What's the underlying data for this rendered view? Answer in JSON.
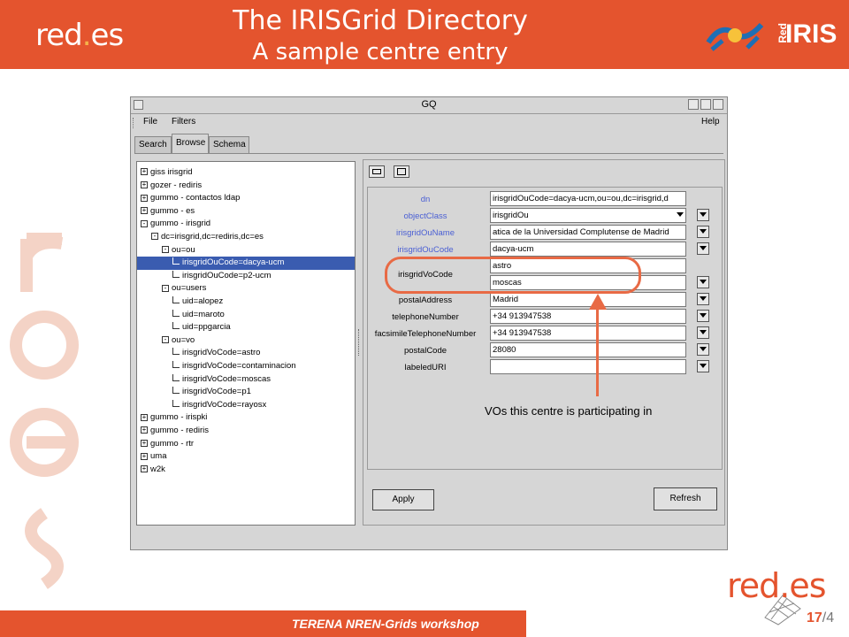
{
  "slide": {
    "title_line1": "The IRISGrid Directory",
    "title_line2": "A sample centre entry",
    "logo_left": "red",
    "logo_left_dot": ".",
    "logo_left_suffix": "es",
    "rediris_small": "Red",
    "rediris_big": "IRIS",
    "footer": "TERENA NREN-Grids workshop",
    "page_current": "17",
    "page_sep": "/",
    "page_total": "4",
    "logo_bottom": "red.es",
    "annotation": "VOs this centre is participating in",
    "colors": {
      "accent": "#e4542e",
      "highlight": "#e86a45",
      "selection": "#3a5cb0",
      "attr_label_blue": "#4a5fd4"
    }
  },
  "window": {
    "title": "GQ",
    "menu": {
      "file": "File",
      "filters": "Filters",
      "help": "Help"
    },
    "tabs": [
      "Search",
      "Browse",
      "Schema"
    ],
    "active_tab": "Browse",
    "tree": [
      {
        "label": "giss irisgrid",
        "type": "expander",
        "sign": "+",
        "level": 0
      },
      {
        "label": "gozer - rediris",
        "type": "expander",
        "sign": "+",
        "level": 0
      },
      {
        "label": "gummo - contactos ldap",
        "type": "expander",
        "sign": "+",
        "level": 0
      },
      {
        "label": "gummo - es",
        "type": "expander",
        "sign": "+",
        "level": 0
      },
      {
        "label": "gummo - irisgrid",
        "type": "expander",
        "sign": "-",
        "level": 0
      },
      {
        "label": "dc=irisgrid,dc=rediris,dc=es",
        "type": "expander",
        "sign": "-",
        "level": 1
      },
      {
        "label": "ou=ou",
        "type": "expander",
        "sign": "-",
        "level": 2
      },
      {
        "label": "irisgridOuCode=dacya-ucm",
        "type": "leaf",
        "level": 3,
        "selected": true
      },
      {
        "label": "irisgridOuCode=p2-ucm",
        "type": "leaf",
        "level": 3
      },
      {
        "label": "ou=users",
        "type": "expander",
        "sign": "-",
        "level": 2
      },
      {
        "label": "uid=alopez",
        "type": "leaf",
        "level": 3
      },
      {
        "label": "uid=maroto",
        "type": "leaf",
        "level": 3
      },
      {
        "label": "uid=ppgarcia",
        "type": "leaf",
        "level": 3
      },
      {
        "label": "ou=vo",
        "type": "expander",
        "sign": "-",
        "level": 2
      },
      {
        "label": "irisgridVoCode=astro",
        "type": "leaf",
        "level": 3
      },
      {
        "label": "irisgridVoCode=contaminacion",
        "type": "leaf",
        "level": 3
      },
      {
        "label": "irisgridVoCode=moscas",
        "type": "leaf",
        "level": 3
      },
      {
        "label": "irisgridVoCode=p1",
        "type": "leaf",
        "level": 3
      },
      {
        "label": "irisgridVoCode=rayosx",
        "type": "leaf",
        "level": 3
      },
      {
        "label": "gummo - irispki",
        "type": "expander",
        "sign": "+",
        "level": 0
      },
      {
        "label": "gummo - rediris",
        "type": "expander",
        "sign": "+",
        "level": 0
      },
      {
        "label": "gummo - rtr",
        "type": "expander",
        "sign": "+",
        "level": 0
      },
      {
        "label": "uma",
        "type": "expander",
        "sign": "+",
        "level": 0
      },
      {
        "label": "w2k",
        "type": "expander",
        "sign": "+",
        "level": 0
      }
    ],
    "attributes": {
      "dn": {
        "label": "dn",
        "value": "irisgridOuCode=dacya-ucm,ou=ou,dc=irisgrid,d"
      },
      "objectClass": {
        "label": "objectClass",
        "value": "irisgridOu"
      },
      "irisgridOuName": {
        "label": "irisgridOuName",
        "value": "atica de la Universidad Complutense de Madrid"
      },
      "irisgridOuCode": {
        "label": "irisgridOuCode",
        "value": "dacya-ucm"
      },
      "irisgridVoCode": {
        "label": "irisgridVoCode",
        "values": [
          "astro",
          "moscas"
        ]
      },
      "postalAddress": {
        "label": "postalAddress",
        "value": "Madrid"
      },
      "telephoneNumber": {
        "label": "telephoneNumber",
        "value": "+34 913947538"
      },
      "facsimileTelephoneNumber": {
        "label": "facsimileTelephoneNumber",
        "value": "+34 913947538"
      },
      "postalCode": {
        "label": "postalCode",
        "value": "28080"
      },
      "labeledURI": {
        "label": "labeledURI",
        "value": ""
      }
    },
    "buttons": {
      "apply": "Apply",
      "refresh": "Refresh"
    }
  }
}
